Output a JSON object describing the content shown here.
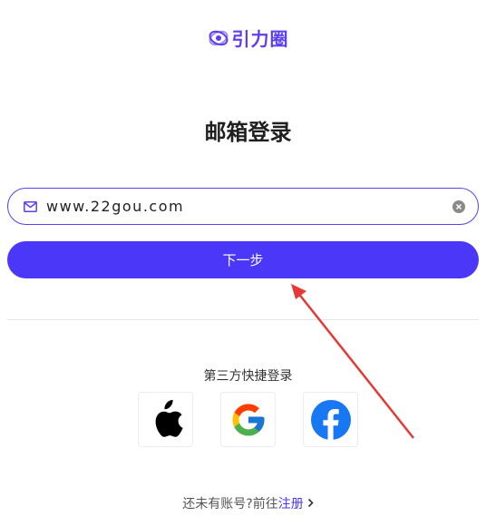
{
  "logo": {
    "text": "引力圈",
    "icon": "orbit-logo-icon",
    "color": "#5b3ff0"
  },
  "title": "邮箱登录",
  "email": {
    "value": "www.22gou.com",
    "icon": "mail-icon",
    "clear_icon": "clear-icon"
  },
  "next_button": {
    "label": "下一步",
    "color": "#4a37f7"
  },
  "third_party": {
    "label": "第三方快捷登录",
    "providers": [
      {
        "name": "apple",
        "icon": "apple-icon"
      },
      {
        "name": "google",
        "icon": "google-icon"
      },
      {
        "name": "facebook",
        "icon": "facebook-icon"
      }
    ]
  },
  "register": {
    "prompt": "还未有账号?前往",
    "link": "注册",
    "icon": "chevron-right-icon"
  },
  "annotation": {
    "color": "#e53935",
    "icon": "red-arrow-annotation"
  }
}
